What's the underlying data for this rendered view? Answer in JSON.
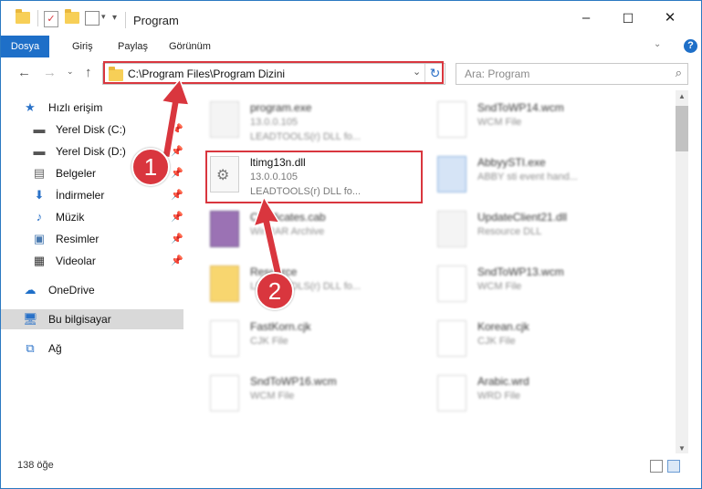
{
  "window": {
    "title": "Program",
    "controls": {
      "minimize": "–",
      "maximize": "☐",
      "close": "✕"
    }
  },
  "ribbon": {
    "tabs": [
      "Dosya",
      "Giriş",
      "Paylaş",
      "Görünüm"
    ],
    "help": "?"
  },
  "address": {
    "path": "C:\\Program Files\\Program Dizini",
    "search_placeholder": "Ara: Program"
  },
  "sidebar": {
    "items": [
      {
        "label": "Hızlı erişim",
        "icon": "star-icon"
      },
      {
        "label": "Yerel Disk (C:)",
        "icon": "drive-icon",
        "pinned": true
      },
      {
        "label": "Yerel Disk (D:)",
        "icon": "drive-icon",
        "pinned": true
      },
      {
        "label": "Belgeler",
        "icon": "documents-icon",
        "pinned": true
      },
      {
        "label": "İndirmeler",
        "icon": "downloads-icon",
        "pinned": true
      },
      {
        "label": "Müzik",
        "icon": "music-icon",
        "pinned": true
      },
      {
        "label": "Resimler",
        "icon": "pictures-icon",
        "pinned": true
      },
      {
        "label": "Videolar",
        "icon": "videos-icon",
        "pinned": true
      },
      {
        "label": "OneDrive",
        "icon": "cloud-icon"
      },
      {
        "label": "Bu bilgisayar",
        "icon": "computer-icon",
        "selected": true
      },
      {
        "label": "Ağ",
        "icon": "network-icon"
      }
    ]
  },
  "files": [
    {
      "name": "program.exe",
      "line2": "13.0.0.105",
      "line3": "LEADTOOLS(r) DLL fo..."
    },
    {
      "name": "SndToWP14.wcm",
      "line2": "WCM File",
      "line3": ""
    },
    {
      "name": "ltimg13n.dll",
      "line2": "13.0.0.105",
      "line3": "LEADTOOLS(r) DLL fo..."
    },
    {
      "name": "AbbyySTI.exe",
      "line2": "ABBY sti event hand...",
      "line3": ""
    },
    {
      "name": "Certificates.cab",
      "line2": "WinRAR Archive",
      "line3": ""
    },
    {
      "name": "UpdateClient21.dll",
      "line2": "Resource DLL",
      "line3": ""
    },
    {
      "name": "Resource",
      "line2": "LEADTOOLS(r) DLL fo...",
      "line3": ""
    },
    {
      "name": "SndToWP13.wcm",
      "line2": "WCM File",
      "line3": ""
    },
    {
      "name": "FastKorn.cjk",
      "line2": "CJK File",
      "line3": ""
    },
    {
      "name": "Korean.cjk",
      "line2": "CJK File",
      "line3": ""
    },
    {
      "name": "SndToWP16.wcm",
      "line2": "WCM File",
      "line3": ""
    },
    {
      "name": "Arabic.wrd",
      "line2": "WRD File",
      "line3": ""
    }
  ],
  "status": {
    "count": "138 öğe"
  },
  "callouts": [
    "1",
    "2"
  ],
  "colors": {
    "accent": "#1e6fc8",
    "highlight": "#d9363e"
  }
}
